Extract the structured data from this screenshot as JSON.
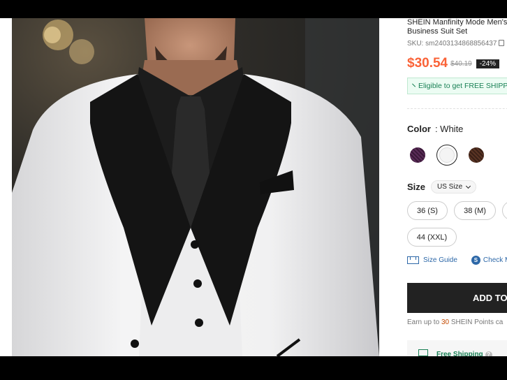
{
  "product": {
    "title": "SHEIN Manfinity Mode Men's Business Suit Set",
    "sku_label": "SKU: sm2403134868856437",
    "price": "$30.54",
    "original_price": "$40.19",
    "discount": "-24%",
    "shipping_banner": "Eligible to get FREE SHIPPING"
  },
  "color": {
    "label": "Color",
    "value": ": White",
    "swatches": [
      {
        "name": "purple",
        "color": "#4a2448"
      },
      {
        "name": "white",
        "color": "#f4f4f4"
      },
      {
        "name": "brown",
        "color": "#4a2a1e"
      }
    ]
  },
  "size": {
    "label": "Size",
    "system": "US Size",
    "options": [
      "36 (S)",
      "38 (M)",
      "",
      "44 (XXL)"
    ]
  },
  "links": {
    "size_guide": "Size Guide",
    "check_fit": "Check My Size"
  },
  "cart": {
    "add_button": "ADD TO CART",
    "points_prefix": "Earn up to",
    "points_value": "30",
    "points_suffix": "SHEIN Points ca"
  },
  "free_shipping": {
    "label": "Free Shipping",
    "help": "?"
  }
}
